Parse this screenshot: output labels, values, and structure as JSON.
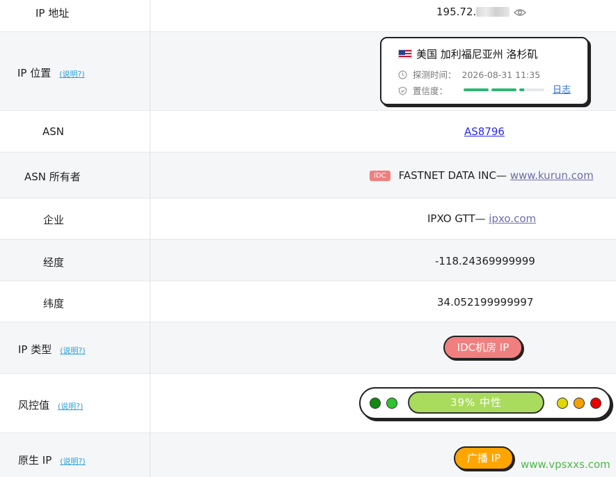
{
  "help_label": "(说明?)",
  "rows": {
    "ip": {
      "label": "IP 地址",
      "value_prefix": "195.72."
    },
    "location": {
      "label": "IP 位置",
      "place": "美国 加利福尼亚州 洛杉矶",
      "probe_label": "探测时间：",
      "probe_time": "2026-08-31 11:35",
      "confidence_label": "置信度：",
      "log_label": "日志",
      "confidence_level": 0.83
    },
    "asn": {
      "label": "ASN",
      "value": "AS8796"
    },
    "asn_owner": {
      "label": "ASN 所有者",
      "badge": "IDC",
      "name": "FASTNET DATA INC— ",
      "link": "www.kurun.com"
    },
    "company": {
      "label": "企业",
      "name": "IPXO GTT— ",
      "link": "ipxo.com"
    },
    "longitude": {
      "label": "经度",
      "value": "-118.24369999999"
    },
    "latitude": {
      "label": "纬度",
      "value": "34.052199999997"
    },
    "ip_type": {
      "label": "IP 类型",
      "value": "IDC机房 IP"
    },
    "risk": {
      "label": "风控值",
      "value": "39%  中性",
      "percent": 39
    },
    "native_ip": {
      "label": "原生 IP",
      "value": "广播 IP"
    }
  },
  "watermark": "www.vpsxxs.com",
  "colors": {
    "accent_link": "#2a2aee",
    "help": "#2aa0d8",
    "idc_red": "#f07f7f",
    "risk_green": "#a9dc5c",
    "broadcast_orange": "#ffa500",
    "confidence_green": "#2bb673"
  }
}
